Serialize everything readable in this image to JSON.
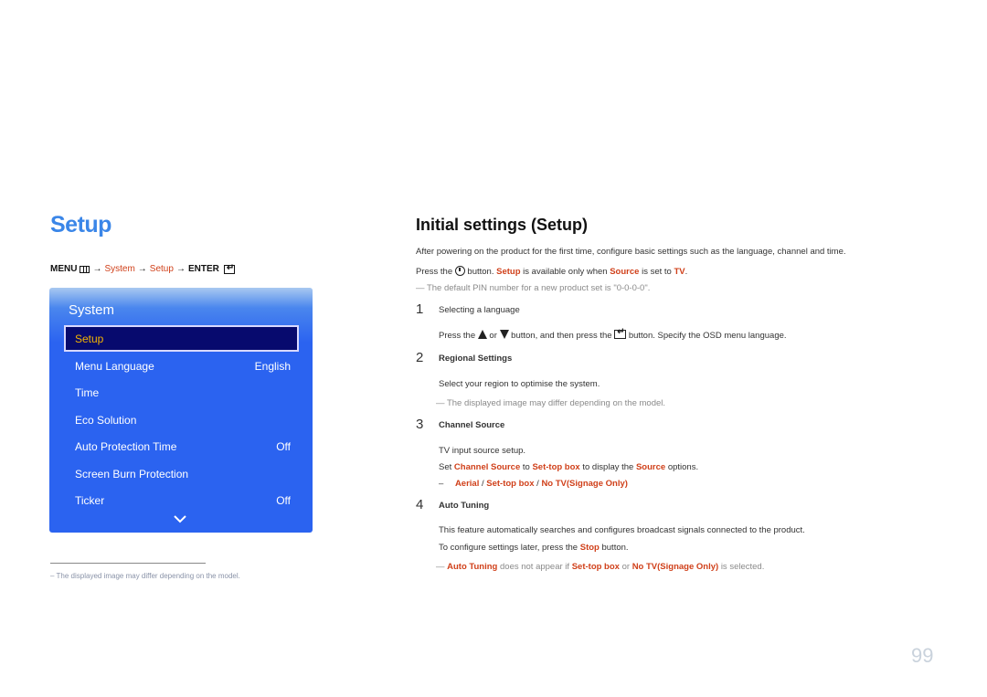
{
  "left": {
    "title": "Setup",
    "breadcrumb": {
      "menu": "MENU",
      "arrow": "→",
      "system": "System",
      "setup": "Setup",
      "enter": "ENTER"
    },
    "osd": {
      "title": "System",
      "selected": "Setup",
      "items": [
        {
          "label": "Menu Language",
          "value": "English"
        },
        {
          "label": "Time",
          "value": ""
        },
        {
          "label": "Eco Solution",
          "value": ""
        },
        {
          "label": "Auto Protection Time",
          "value": "Off"
        },
        {
          "label": "Screen Burn Protection",
          "value": ""
        },
        {
          "label": "Ticker",
          "value": "Off"
        }
      ]
    },
    "footnote": "The displayed image may differ depending on the model.",
    "footnote_dash": "–"
  },
  "right": {
    "title": "Initial settings (Setup)",
    "intro": "After powering on the product for the first time, configure basic settings such as the language, channel and time.",
    "press": {
      "a": "Press the",
      "b": "button.",
      "setup": "Setup",
      "c": "is available only when",
      "source": "Source",
      "d": "is set to",
      "tv": "TV",
      "e": "."
    },
    "pin_note": "The default PIN number for a new product set is \"0-0-0-0\".",
    "note_dash": "―",
    "steps": [
      {
        "num": "1",
        "title": "Selecting a language",
        "body": {
          "a": "Press the",
          "or": "or",
          "b": "button, and then press the",
          "c": "button. Specify the OSD menu language."
        }
      },
      {
        "num": "2",
        "title": "Regional Settings",
        "body": "Select your region to optimise the system.",
        "note": "The displayed image may differ depending on the model."
      },
      {
        "num": "3",
        "title": "Channel Source",
        "body": "TV input source setup.",
        "set": {
          "a": "Set",
          "cs": "Channel Source",
          "to": "to",
          "stb": "Set-top box",
          "b": "to display the",
          "source": "Source",
          "c": "options."
        },
        "options": {
          "dash": "–",
          "aerial": "Aerial",
          "sep": "/",
          "stb": "Set-top box",
          "notv": "No TV(Signage Only)"
        }
      },
      {
        "num": "4",
        "title": "Auto Tuning",
        "body": "This feature automatically searches and configures broadcast signals connected to the product.",
        "stop": {
          "a": "To configure settings later, press the",
          "stop": "Stop",
          "b": "button."
        },
        "note": {
          "at": "Auto Tuning",
          "a": "does not appear if",
          "stb": "Set-top box",
          "or": "or",
          "notv": "No TV(Signage Only)",
          "b": "is selected."
        }
      }
    ]
  },
  "page_number": "99"
}
